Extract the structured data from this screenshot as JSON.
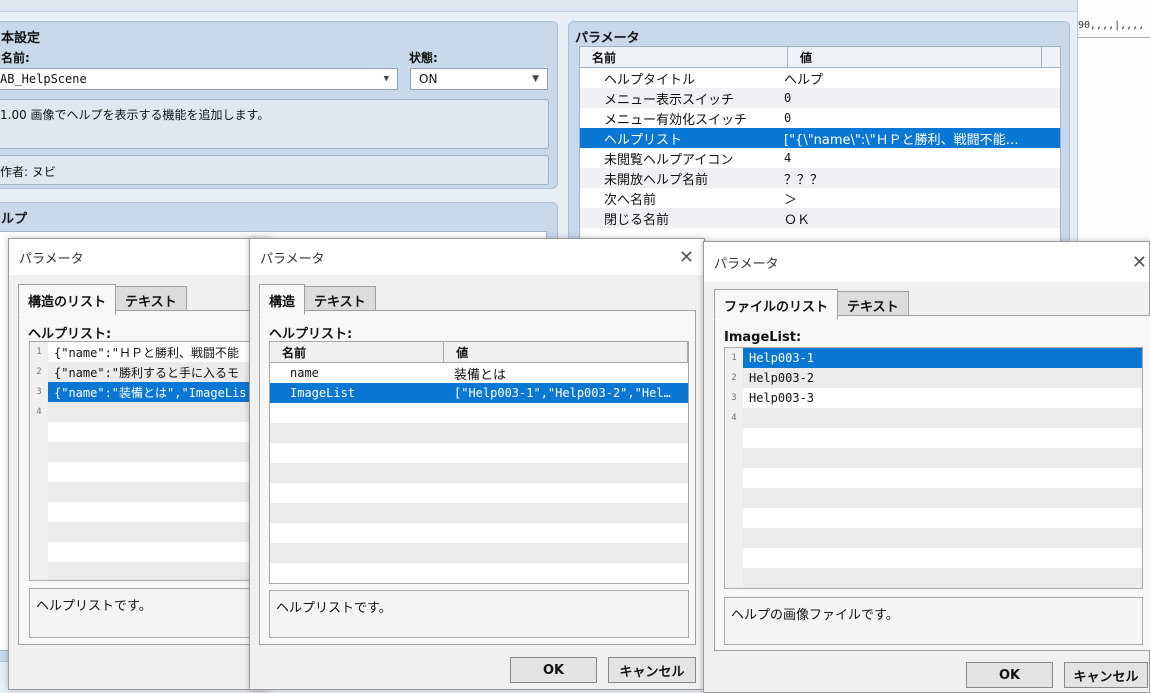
{
  "main": {
    "basic": {
      "title": "本設定",
      "name_label": "名前:",
      "state_label": "状態:",
      "plugin_name": "AB_HelpScene",
      "state_value": "ON",
      "description": "1.00 画像でヘルプを表示する機能を追加します。",
      "author": "作者: ヌビ"
    },
    "help": {
      "title": "ルプ"
    },
    "params": {
      "title": "パラメータ",
      "col_name": "名前",
      "col_value": "値",
      "rows": [
        {
          "name": "ヘルプタイトル",
          "value": "ヘルプ"
        },
        {
          "name": "メニュー表示スイッチ",
          "value": "0"
        },
        {
          "name": "メニュー有効化スイッチ",
          "value": "0"
        },
        {
          "name": "ヘルプリスト",
          "value": "[\"{\\\"name\\\":\\\"ＨＰと勝利、戦闘不能…"
        },
        {
          "name": "未閲覧ヘルプアイコン",
          "value": "4"
        },
        {
          "name": "未開放ヘルプ名前",
          "value": "？？？"
        },
        {
          "name": "次へ名前",
          "value": "＞"
        },
        {
          "name": "閉じる名前",
          "value": "ＯＫ"
        }
      ]
    },
    "ruler": "90,,,,|,,,,"
  },
  "dialog1": {
    "title": "パラメータ",
    "tabs": [
      "構造のリスト",
      "テキスト"
    ],
    "list_label": "ヘルプリスト:",
    "items": [
      "{\"name\":\"ＨＰと勝利、戦闘不能",
      "{\"name\":\"勝利すると手に入るモ",
      "{\"name\":\"装備とは\",\"ImageLis"
    ],
    "line_numbers": [
      "1",
      "2",
      "3",
      "4"
    ],
    "description": "ヘルプリストです。"
  },
  "dialog2": {
    "title": "パラメータ",
    "tabs": [
      "構造",
      "テキスト"
    ],
    "list_label": "ヘルプリスト:",
    "col_name": "名前",
    "col_value": "値",
    "rows": [
      {
        "name": "name",
        "value": "装備とは"
      },
      {
        "name": "ImageList",
        "value": "[\"Help003-1\",\"Help003-2\",\"Hel…"
      }
    ],
    "description": "ヘルプリストです。",
    "ok": "OK",
    "cancel": "キャンセル"
  },
  "dialog3": {
    "title": "パラメータ",
    "tabs": [
      "ファイルのリスト",
      "テキスト"
    ],
    "list_label": "ImageList:",
    "items": [
      "Help003-1",
      "Help003-2",
      "Help003-3"
    ],
    "line_numbers": [
      "1",
      "2",
      "3",
      "4"
    ],
    "description": "ヘルプの画像ファイルです。",
    "ok": "OK",
    "cancel": "キャンセル"
  }
}
